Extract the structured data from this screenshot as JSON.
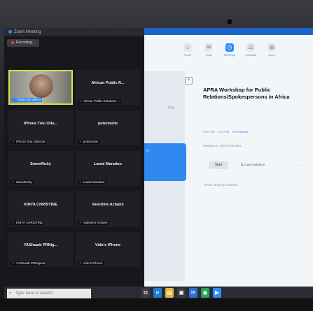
{
  "zoom": {
    "window_title": "Zoom Meeting",
    "recording_label": "Recording...",
    "tiles": [
      {
        "name": "",
        "label": "Robyn de Villiers",
        "active": true
      },
      {
        "name": "African Public R...",
        "label": "African Public Relations ..."
      },
      {
        "name": "iPhone Tolu Odu...",
        "label": "iPhone Tolu Odusote"
      },
      {
        "name": "petermutie",
        "label": "petermutie"
      },
      {
        "name": "SweetRuby",
        "label": "SweetRuby"
      },
      {
        "name": "Lawal Maradun",
        "label": "Lawal Maradun"
      },
      {
        "name": "KINYA CHRISTINE",
        "label": "KINYA CHRISTINE"
      },
      {
        "name": "Valentine Achaire",
        "label": "Valentine Achaire"
      },
      {
        "name": "YASfuaab PRNig...",
        "label": "YASfuaab PRNigeria"
      },
      {
        "name": "Vido's iPhone",
        "label": "Vido's iPhone"
      }
    ]
  },
  "client": {
    "nav": [
      {
        "icon": "home-icon",
        "glyph": "⌂",
        "label": "Home"
      },
      {
        "icon": "chat-icon",
        "glyph": "✉",
        "label": "Chat"
      },
      {
        "icon": "meetings-icon",
        "glyph": "◷",
        "label": "Meetings",
        "active": true
      },
      {
        "icon": "contacts-icon",
        "glyph": "☷",
        "label": "Contacts"
      },
      {
        "icon": "apps-icon",
        "glyph": "⊞",
        "label": "Apps"
      }
    ],
    "side_time": "PM)",
    "blue_card_text": "m",
    "meeting_title": "APRA Workshop for Public Relations/Spokespersons in Africa",
    "meeting_time": "9:00 AM - 4:15 PM",
    "meeting_status": "In Progress",
    "meeting_id": "Meeting ID: 838 8729 5621",
    "start_label": "Start",
    "copy_invitation_label": "Copy Invitation",
    "more_label": "...",
    "show_participants_label": "Show Meeting Invitation"
  },
  "taskbar": {
    "search_placeholder": "Type here to search",
    "apps": [
      {
        "icon": "task-view-icon",
        "glyph": "⧉",
        "color": "#3a3b42"
      },
      {
        "icon": "edge-icon",
        "glyph": "e",
        "color": "#1c7fd6"
      },
      {
        "icon": "file-explorer-icon",
        "glyph": "▤",
        "color": "#e7b43c"
      },
      {
        "icon": "store-icon",
        "glyph": "▣",
        "color": "#3a3b42"
      },
      {
        "icon": "mail-icon",
        "glyph": "✉",
        "color": "#2a6fd0"
      },
      {
        "icon": "chrome-icon",
        "glyph": "◉",
        "color": "#2da05a"
      },
      {
        "icon": "zoom-icon",
        "glyph": "▶",
        "color": "#2d8cff"
      }
    ]
  }
}
